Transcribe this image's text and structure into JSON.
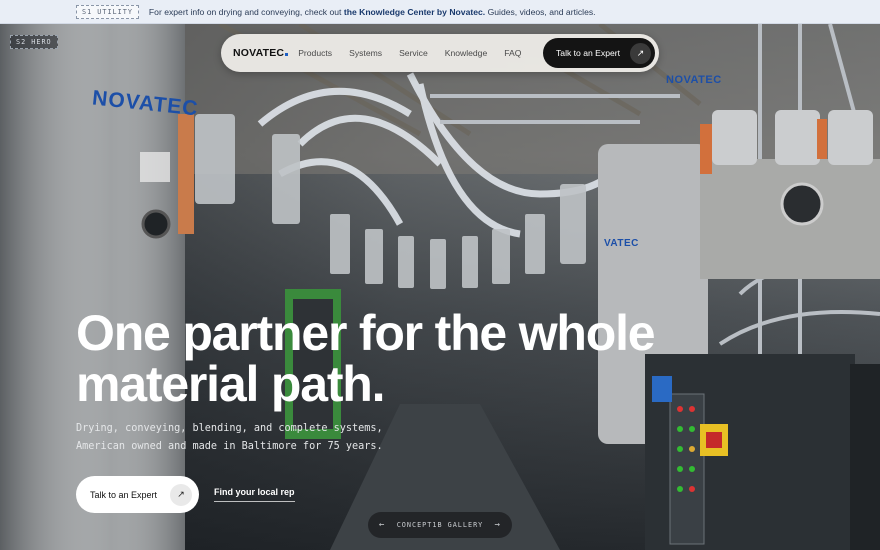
{
  "utility": {
    "tag": "S1 UTILITY",
    "text_before": "For expert info on drying and conveying, check out ",
    "link_text": "the Knowledge Center by Novatec.",
    "text_after": " Guides, videos, and articles."
  },
  "hero": {
    "tag": "S2 HERO",
    "machine_brand": "NOVATEC",
    "machine_brand_small": "VATEC",
    "headline_line1": "One partner for the whole",
    "headline_line2": "material path.",
    "sub_line1": "Drying, conveying, blending, and complete systems,",
    "sub_line2": "American owned and made in Baltimore for 75 years.",
    "cta_primary": "Talk to an Expert",
    "cta_secondary": "Find your local rep",
    "gallery_label": "CONCEPT1B GALLERY",
    "gallery_prev": "←",
    "gallery_next": "→"
  },
  "nav": {
    "logo": "NOVATEC",
    "items": [
      "Products",
      "Systems",
      "Service",
      "Knowledge",
      "FAQ"
    ],
    "cta": "Talk to an Expert",
    "cta_icon": "↗"
  },
  "colors": {
    "utility_bg": "#e9eef6",
    "brand_blue": "#1d5fc4",
    "nav_bg": "#eeece8",
    "cta_dark": "#141414"
  },
  "icons": {
    "arrow": "arrow-up-right-icon"
  }
}
